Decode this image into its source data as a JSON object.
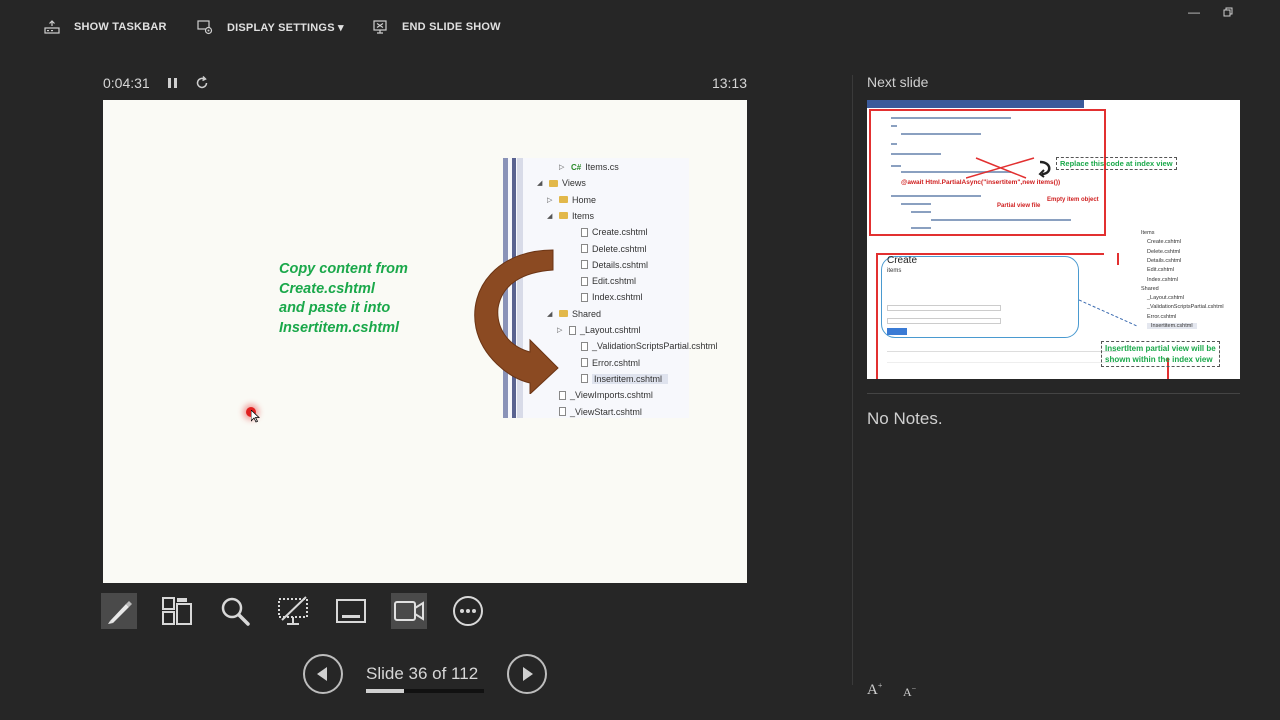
{
  "toolbar": {
    "show_taskbar": "SHOW TASKBAR",
    "display_settings": "DISPLAY SETTINGS ▾",
    "end_slide_show": "END SLIDE SHOW"
  },
  "presenter": {
    "elapsed_time": "0:04:31",
    "clock": "13:13"
  },
  "slide": {
    "body_lines": [
      "Copy content from",
      "Create.cshtml",
      "and paste it  into",
      "Insertitem.cshtml"
    ],
    "tree": [
      {
        "label": "Items.cs",
        "kind": "cs",
        "arrow": "▷"
      },
      {
        "label": "Views",
        "kind": "folder",
        "arrow": "◢"
      },
      {
        "label": "Home",
        "kind": "folder",
        "arrow": "▷"
      },
      {
        "label": "Items",
        "kind": "folder",
        "arrow": "◢"
      },
      {
        "label": "Create.cshtml",
        "kind": "file",
        "arrow": ""
      },
      {
        "label": "Delete.cshtml",
        "kind": "file",
        "arrow": ""
      },
      {
        "label": "Details.cshtml",
        "kind": "file",
        "arrow": ""
      },
      {
        "label": "Edit.cshtml",
        "kind": "file",
        "arrow": ""
      },
      {
        "label": "Index.cshtml",
        "kind": "file",
        "arrow": ""
      },
      {
        "label": "Shared",
        "kind": "folder",
        "arrow": "◢"
      },
      {
        "label": "_Layout.cshtml",
        "kind": "file",
        "arrow": "▷"
      },
      {
        "label": "_ValidationScriptsPartial.cshtml",
        "kind": "file",
        "arrow": ""
      },
      {
        "label": "Error.cshtml",
        "kind": "file",
        "arrow": ""
      },
      {
        "label": "Insertitem.cshtml",
        "kind": "file",
        "arrow": "",
        "highlight": true
      },
      {
        "label": "_ViewImports.cshtml",
        "kind": "file",
        "arrow": ""
      },
      {
        "label": "_ViewStart.cshtml",
        "kind": "file",
        "arrow": ""
      }
    ]
  },
  "navigation": {
    "slide_label": "Slide 36 of 112",
    "current": 36,
    "total": 112
  },
  "next_slide": {
    "label": "Next slide",
    "thumb": {
      "replace_note": "Replace this code at index view",
      "partial_view_file": "Partial view file",
      "empty_item_object": "Empty item object",
      "code_call": "@await Html.PartialAsync(\"insertitem\",new items())",
      "form_title": "Create",
      "form_subtitle": "items",
      "partial_note_line1": "InsertItem partial view will be",
      "partial_note_line2": "shown within the index view",
      "tree": [
        "Items",
        "Create.cshtml",
        "Delete.cshtml",
        "Details.cshtml",
        "Edit.cshtml",
        "Index.cshtml",
        "Shared",
        "_Layout.cshtml",
        "_ValidationScriptsPartial.cshtml",
        "Error.cshtml",
        "Insertitem.cshtml"
      ]
    }
  },
  "notes": {
    "text": "No Notes."
  },
  "colors": {
    "background": "#262626",
    "slide_green": "#1aa84a",
    "arrow_brown": "#8b4a22",
    "annotation_red": "#e23030"
  }
}
